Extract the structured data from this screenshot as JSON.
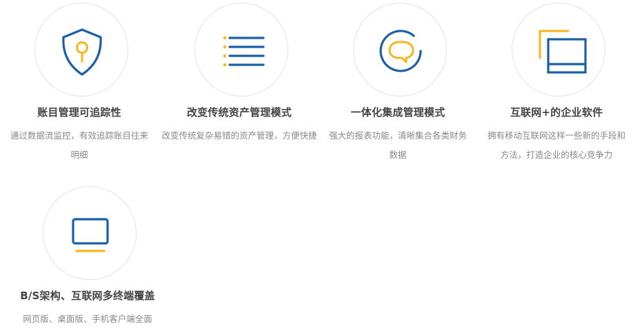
{
  "colors": {
    "blue": "#1a5fa6",
    "yellow": "#f7b51b",
    "title": "#444444",
    "desc": "#888888",
    "circle_border": "#e2e2e2"
  },
  "features": [
    {
      "icon": "shield-key-icon",
      "title": "账目管理可追踪性",
      "desc": "通过数据流监控，有效追踪账目往来明细"
    },
    {
      "icon": "list-icon",
      "title": "改变传统资产管理模式",
      "desc": "改变传统复杂易错的资产管理，方便快捷"
    },
    {
      "icon": "chat-bubble-icon",
      "title": "一体化集成管理模式",
      "desc": "强大的报表功能，清晰集合各类财务数据"
    },
    {
      "icon": "windows-icon",
      "title": "互联网+的企业软件",
      "desc": "拥有移动互联网这样一些新的手段和方法，打造企业的核心竞争力"
    },
    {
      "icon": "monitor-icon",
      "title": "B/S架构、互联网多终端覆盖",
      "desc": "网页版、桌面版、手机客户端全面"
    }
  ]
}
